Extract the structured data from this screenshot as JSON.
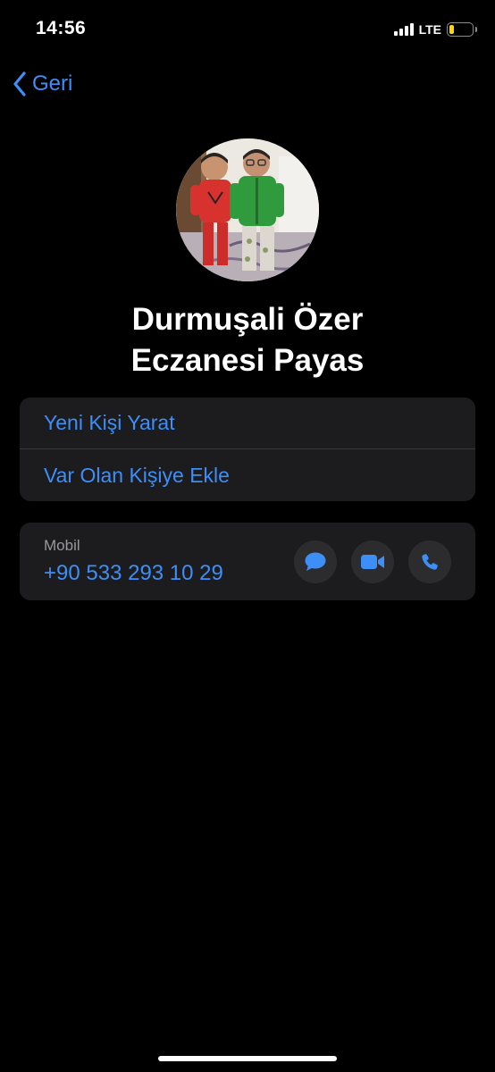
{
  "status_bar": {
    "time": "14:56",
    "network": "LTE",
    "battery_level": 0.2,
    "battery_color": "#ffd60a",
    "signal_bars": 4
  },
  "nav": {
    "back_label": "Geri",
    "back_icon": "chevron-left-icon"
  },
  "contact": {
    "name_line1": "Durmuşali Özer",
    "name_line2": "Eczanesi Payas",
    "avatar": "contact-photo"
  },
  "actions": {
    "create_new": "Yeni Kişi Yarat",
    "add_existing": "Var Olan Kişiye Ekle"
  },
  "phone": {
    "label": "Mobil",
    "number": "+90 533 293 10 29",
    "buttons": [
      "message-icon",
      "video-icon",
      "phone-icon"
    ]
  },
  "colors": {
    "accent": "#3d8ef7",
    "background": "#000000",
    "card": "#1c1c1e",
    "button_bg": "#2c2c2e",
    "secondary_text": "#98989f"
  }
}
